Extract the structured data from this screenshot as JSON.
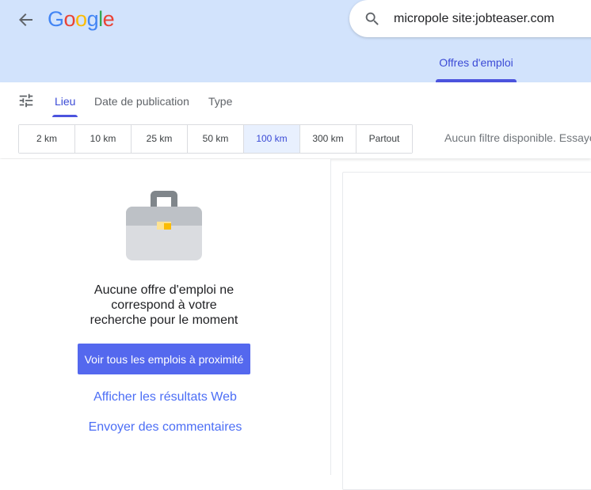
{
  "header": {
    "logo_letters": [
      {
        "ch": "G",
        "color": "#4285F4"
      },
      {
        "ch": "o",
        "color": "#EA4335"
      },
      {
        "ch": "o",
        "color": "#FBBC05"
      },
      {
        "ch": "g",
        "color": "#4285F4"
      },
      {
        "ch": "l",
        "color": "#34A853"
      },
      {
        "ch": "e",
        "color": "#EA4335"
      }
    ],
    "search_query": "micropole site:jobteaser.com",
    "jobs_tab_label": "Offres d'emploi",
    "background_color": "#d2e3fc"
  },
  "filters": {
    "tabs": [
      "Lieu",
      "Date de publication",
      "Type"
    ],
    "active_tab": "Lieu",
    "distances": [
      "2 km",
      "10 km",
      "25 km",
      "50 km",
      "100 km",
      "300 km",
      "Partout"
    ],
    "selected_distance": "100 km",
    "no_filter_text": "Aucun filtre disponible. Essayez"
  },
  "empty_state": {
    "message": "Aucune offre d'emploi ne correspond à votre recherche pour le moment",
    "button_label": "Voir tous les emplois à proximité",
    "web_link": "Afficher les résultats Web",
    "feedback_link": "Envoyer des commentaires"
  },
  "colors": {
    "accent": "#4c54de",
    "button": "#5468ee",
    "link": "#4c6ef5"
  },
  "icons": [
    "back-arrow-icon",
    "search-icon",
    "tune-icon",
    "briefcase-icon"
  ]
}
